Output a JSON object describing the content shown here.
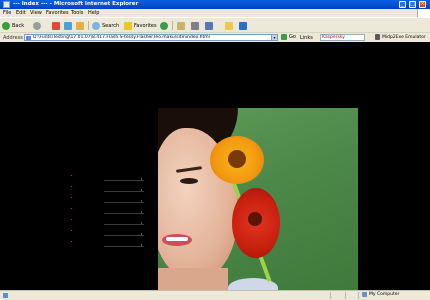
{
  "window": {
    "title": "--- Index --- - Microsoft Internet Explorer"
  },
  "menu": [
    "File",
    "Edit",
    "View",
    "Favorites",
    "Tools",
    "Help"
  ],
  "toolbar": {
    "back": "Back",
    "search": "Search",
    "favorites": "Favorites"
  },
  "address": {
    "label": "Address",
    "value": "D:\\Funts\\Testing\\17.01.07\\8.417.Flash.S-tessy.Flasher.leo.maku\\site\\index.html",
    "go": "Go",
    "links": "Links",
    "extra": "Kaspersky",
    "emulator": "Midp2Exe Emulator"
  },
  "status": {
    "zone": "My Computer"
  },
  "nav": {
    "count": 7
  },
  "colors": {
    "accent": "#0453d8",
    "chrome": "#ece9d8"
  }
}
